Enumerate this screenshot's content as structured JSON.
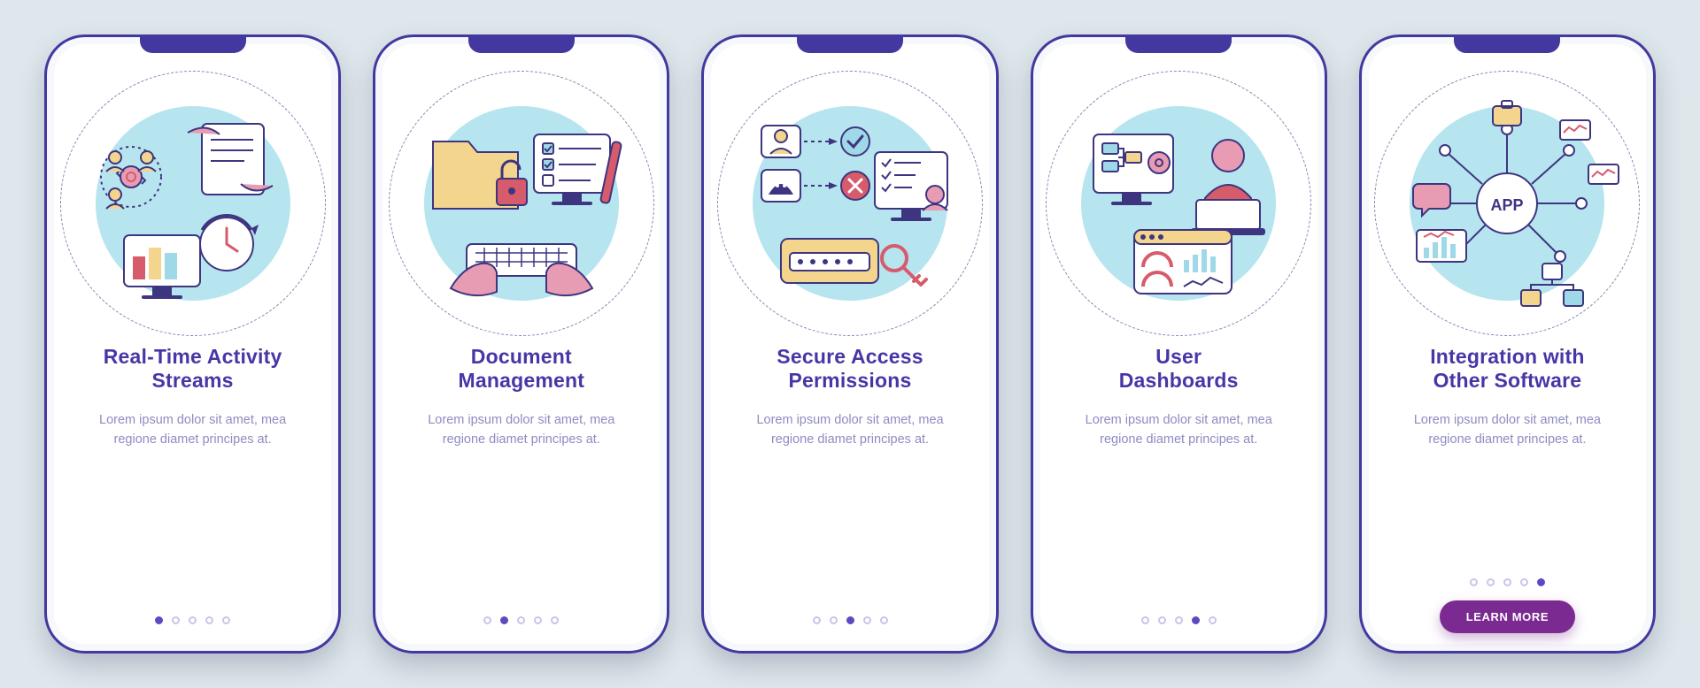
{
  "total_dots": 5,
  "colors": {
    "bg": "#DEE7EB",
    "phone_border": "#43389F",
    "title": "#4A35A6",
    "body_text": "#8E8BC2",
    "dot": "#C9C5E6",
    "dot_active": "#5B4BC2",
    "cta_bg": "#7A2A90",
    "halo": "#B6E5EF",
    "accent_yellow": "#F4D58D",
    "accent_pink": "#E89CB3",
    "accent_red": "#D65B6B",
    "accent_blue": "#9FD8E6"
  },
  "screens": [
    {
      "id": "activity-streams",
      "icon": "activity-streams-illustration",
      "title": "Real-Time Activity\nStreams",
      "description": "Lorem ipsum dolor sit amet, mea regione diamet principes at.",
      "active_dot": 0,
      "has_cta": false
    },
    {
      "id": "document-management",
      "icon": "document-management-illustration",
      "title": "Document\nManagement",
      "description": "Lorem ipsum dolor sit amet, mea regione diamet principes at.",
      "active_dot": 1,
      "has_cta": false
    },
    {
      "id": "secure-access",
      "icon": "secure-access-illustration",
      "title": "Secure Access\nPermissions",
      "description": "Lorem ipsum dolor sit amet, mea regione diamet principes at.",
      "active_dot": 2,
      "has_cta": false
    },
    {
      "id": "user-dashboards",
      "icon": "user-dashboards-illustration",
      "title": "User\nDashboards",
      "description": "Lorem ipsum dolor sit amet, mea regione diamet principes at.",
      "active_dot": 3,
      "has_cta": false
    },
    {
      "id": "integration",
      "icon": "integration-illustration",
      "title": "Integration with\nOther Software",
      "description": "Lorem ipsum dolor sit amet, mea regione diamet principes at.",
      "active_dot": 4,
      "has_cta": true,
      "cta_label": "LEARN MORE"
    }
  ]
}
